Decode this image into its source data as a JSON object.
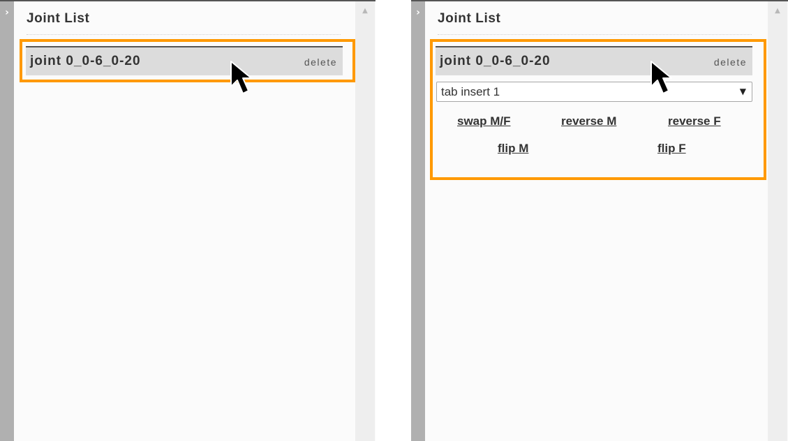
{
  "left_panel": {
    "title": "Joint List",
    "joint": {
      "name": "joint 0_0-6_0-20",
      "delete_label": "delete"
    }
  },
  "right_panel": {
    "title": "Joint List",
    "joint": {
      "name": "joint 0_0-6_0-20",
      "delete_label": "delete"
    },
    "tab_select": {
      "value": "tab insert 1"
    },
    "actions": {
      "swap": "swap M/F",
      "reverse_m": "reverse M",
      "reverse_f": "reverse F",
      "flip_m": "flip M",
      "flip_f": "flip F"
    }
  },
  "colors": {
    "highlight": "#ff9900",
    "row_background": "#dcdcdc",
    "sidebar": "#b0b0b0"
  },
  "icons": {
    "side_toggle": "chevron-right-icon",
    "scroll_up": "scroll-up-arrow-icon",
    "select_caret": "caret-down-icon",
    "cursor": "mouse-pointer-icon"
  }
}
